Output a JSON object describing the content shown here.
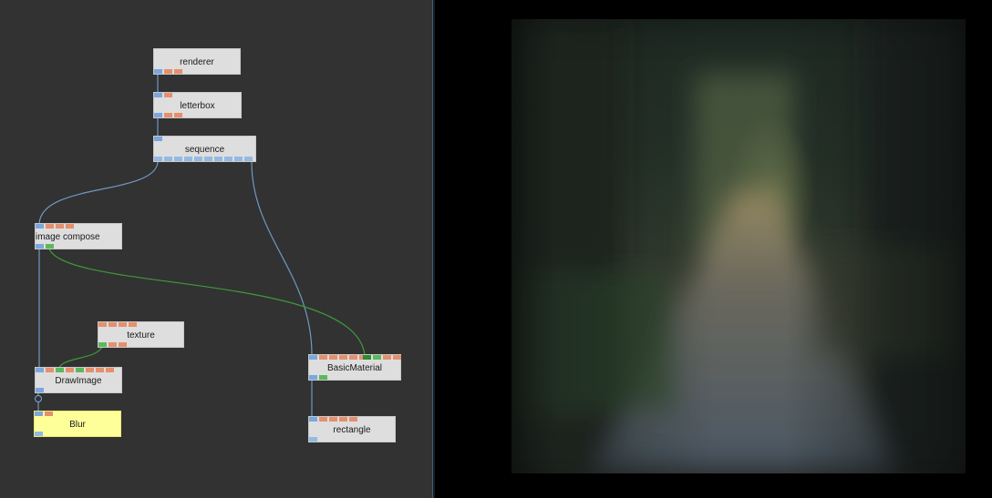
{
  "graph": {
    "nodes": {
      "renderer": {
        "label": "renderer"
      },
      "letterbox": {
        "label": "letterbox"
      },
      "sequence": {
        "label": "sequence"
      },
      "image_compose": {
        "label": "image compose"
      },
      "texture": {
        "label": "texture"
      },
      "drawimage": {
        "label": "DrawImage"
      },
      "blur": {
        "label": "Blur"
      },
      "basicmaterial": {
        "label": "BasicMaterial"
      },
      "rectangle": {
        "label": "rectangle"
      }
    },
    "colors": {
      "background": "#323232",
      "node": "#dedede",
      "node_highlight": "#ffff99",
      "wire_blue": "#6f98c4",
      "wire_green": "#3c9a3c",
      "port_blue": "#7aa7dc",
      "port_orange": "#e58f6d",
      "port_green": "#5cb85c"
    }
  },
  "viewer": {
    "image_description_icon": "forest-road-image"
  }
}
